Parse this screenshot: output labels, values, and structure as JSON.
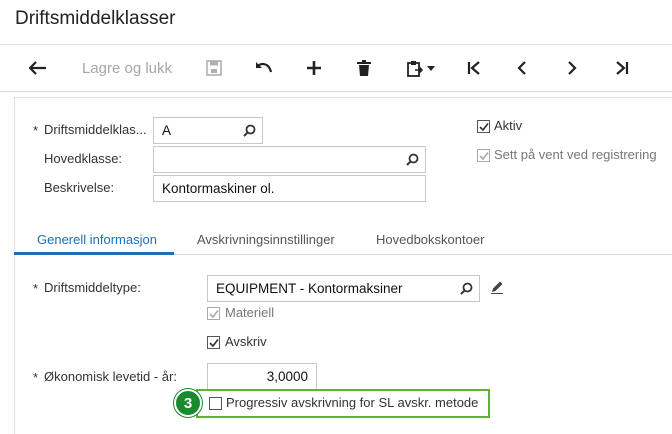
{
  "title": "Driftsmiddelklasser",
  "toolbar": {
    "save_close_label": "Lagre og lukk"
  },
  "header": {
    "class_label": "Driftsmiddelklas...",
    "class_value": "A",
    "main_class_label": "Hovedklasse:",
    "main_class_value": "",
    "description_label": "Beskrivelse:",
    "description_value": "Kontormaskiner ol.",
    "active_label": "Aktiv",
    "hold_label": "Sett på vent ved registrering",
    "required_marker": "*"
  },
  "tabs": [
    {
      "label": "Generell informasjon"
    },
    {
      "label": "Avskrivningsinnstillinger"
    },
    {
      "label": "Hovedbokskontoer"
    }
  ],
  "general": {
    "asset_type_label": "Driftsmiddeltype:",
    "asset_type_value": "EQUIPMENT - Kontormaksiner",
    "tangible_label": "Materiell",
    "depreciate_label": "Avskriv",
    "useful_life_label": "Økonomisk levetid - år:",
    "useful_life_value": "3,0000",
    "progressive_label": "Progressiv avskrivning for SL avskr. metode"
  },
  "callout": {
    "number": "3"
  },
  "colors": {
    "accent": "#1f6fb8",
    "highlight": "#63b233",
    "step_badge": "#1a8a2e"
  }
}
